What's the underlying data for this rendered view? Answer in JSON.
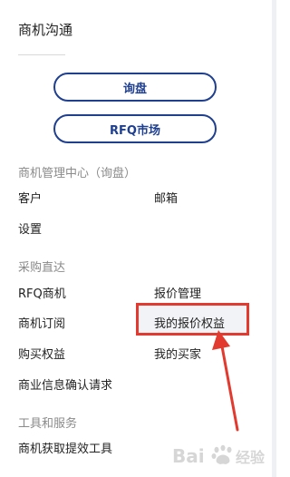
{
  "panel": {
    "title": "商机沟通",
    "buttons": {
      "inquiry": "询盘",
      "rfq_market": "RFQ市场"
    },
    "sections": [
      {
        "heading": "商机管理中心（询盘）",
        "items": [
          "客户",
          "邮箱",
          "设置"
        ]
      },
      {
        "heading": "采购直达",
        "items": [
          "RFQ商机",
          "报价管理",
          "商机订阅",
          "我的报价权益",
          "购买权益",
          "我的买家",
          "商业信息确认请求"
        ]
      },
      {
        "heading": "工具和服务",
        "items": [
          "商机获取提效工具"
        ]
      }
    ]
  },
  "annotation": {
    "color": "#e23a2e"
  },
  "watermark": {
    "text": "Baidu经验"
  },
  "colors": {
    "accent": "#1f3f8f",
    "highlight_red": "#e23a2e"
  }
}
